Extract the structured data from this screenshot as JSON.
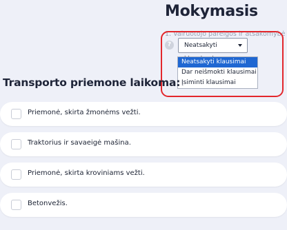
{
  "header": {
    "title": "Mokymasis",
    "subtitle": "1. Vairuotojo pareigos ir atsakomybė"
  },
  "filter": {
    "help_icon": "?",
    "selected": "Neatsakyti klausimai",
    "options": [
      "Neatsakyti klausimai",
      "Dar neišmokti klausimai",
      "Įsiminti klausimai"
    ]
  },
  "question": {
    "text": "Transporto priemone laikoma:",
    "answers": [
      "Priemonė, skirta žmonėms vežti.",
      "Traktorius ir savaeigė mašina.",
      "Priemonė, skirta kroviniams vežti.",
      "Betonvežis."
    ]
  },
  "colors": {
    "accent": "#1f67d2",
    "highlight": "#e3262b",
    "background": "#eef0f8"
  }
}
